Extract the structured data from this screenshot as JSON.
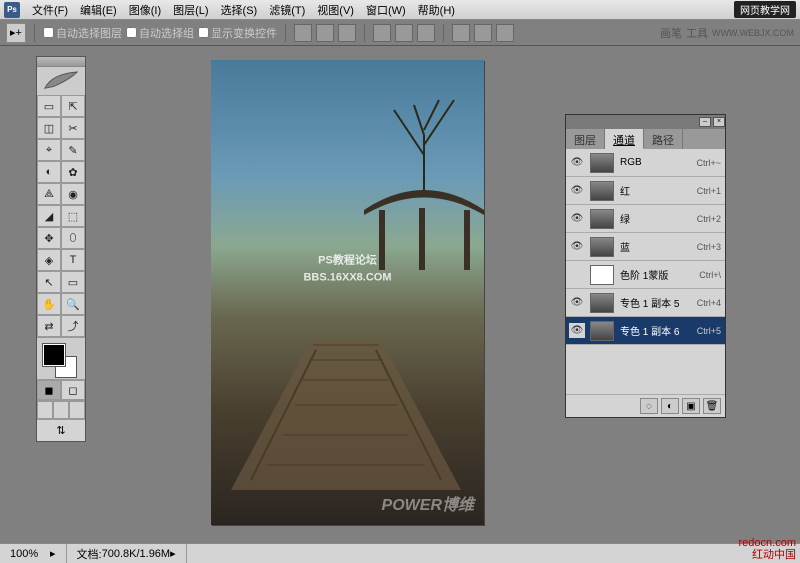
{
  "menubar": {
    "items": [
      "文件(F)",
      "编辑(E)",
      "图像(I)",
      "图层(L)",
      "选择(S)",
      "滤镜(T)",
      "视图(V)",
      "窗口(W)",
      "帮助(H)"
    ],
    "site_badge": "网页教学网"
  },
  "optbar": {
    "auto_select_layer": "自动选择图层",
    "auto_select_group": "自动选择组",
    "show_transform": "显示变换控件",
    "brush_label": "画笔",
    "tool_label": "工具",
    "site": "WWW.WEBJX.COM"
  },
  "canvas": {
    "watermark_line1": "PS教程论坛",
    "watermark_line2": "BBS.16XX8.COM",
    "watermark_corner": "POWER博维"
  },
  "channels": {
    "tabs": [
      "图层",
      "通道",
      "路径"
    ],
    "active_tab": 1,
    "items": [
      {
        "name": "RGB",
        "shortcut": "Ctrl+~",
        "eye": true,
        "thumb": "color"
      },
      {
        "name": "红",
        "shortcut": "Ctrl+1",
        "eye": true,
        "thumb": "gray"
      },
      {
        "name": "绿",
        "shortcut": "Ctrl+2",
        "eye": true,
        "thumb": "gray"
      },
      {
        "name": "蓝",
        "shortcut": "Ctrl+3",
        "eye": true,
        "thumb": "gray"
      },
      {
        "name": "色阶 1蒙版",
        "shortcut": "Ctrl+\\",
        "eye": false,
        "thumb": "white"
      },
      {
        "name": "专色 1 副本 5",
        "shortcut": "Ctrl+4",
        "eye": true,
        "thumb": "gray"
      },
      {
        "name": "专色 1 副本 6",
        "shortcut": "Ctrl+5",
        "eye": true,
        "thumb": "gray",
        "selected": true
      }
    ]
  },
  "statusbar": {
    "zoom": "100%",
    "doc_label": "文档:",
    "doc_value": "700.8K/1.96M"
  },
  "corner_brand": {
    "line1": "redocn.com",
    "line2": "红动中国"
  },
  "tools": [
    "▭",
    "⇱",
    "◫",
    "✂",
    "⌖",
    "✎",
    "◐",
    "✿",
    "⟁",
    "◉",
    "◢",
    "⬚",
    "✥",
    "⬯",
    "◈",
    "T",
    "↖",
    "▭",
    "✋",
    "🔍",
    "⇄",
    "⤴"
  ]
}
